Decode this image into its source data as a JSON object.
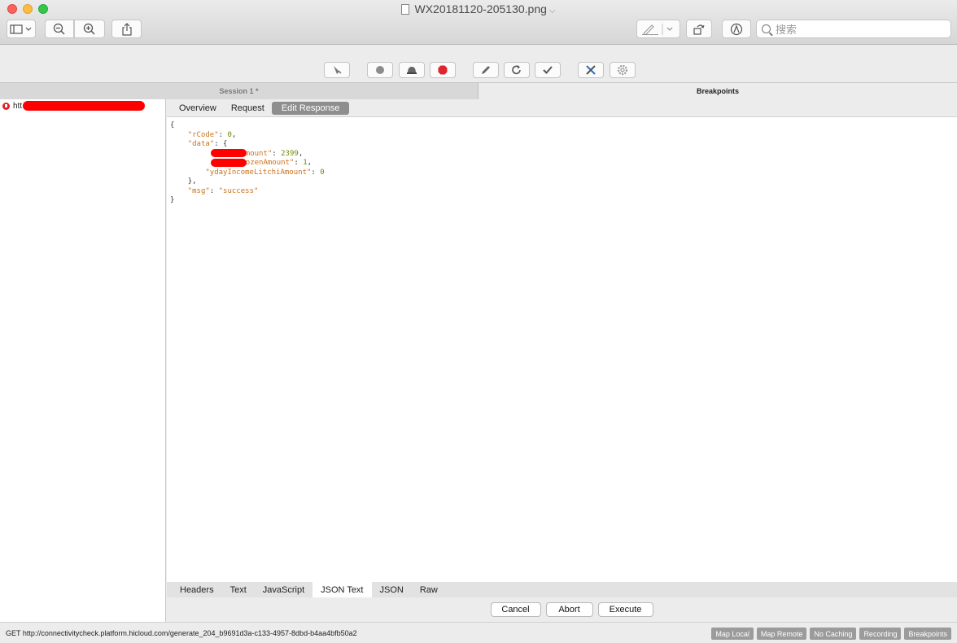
{
  "window": {
    "title": "WX20181120-205130.png",
    "title_chevron": "⌵",
    "search_placeholder": "搜索"
  },
  "charles_toolbar": {
    "icons": [
      "broom-icon",
      "record-icon",
      "throttle-icon",
      "breakpoint-icon",
      "edit-icon",
      "repeat-icon",
      "validate-icon",
      "tools-icon",
      "settings-icon"
    ],
    "breakpoint_color": "#e0242b"
  },
  "header": {
    "session_tab": "Session 1 *",
    "breakpoints_tab": "Breakpoints"
  },
  "tree": {
    "row_label": "htt…              …/account/"
  },
  "tabs_top": [
    "Overview",
    "Request",
    "Edit Response"
  ],
  "active_top_tab": "Edit Response",
  "editor": {
    "lines": [
      "{",
      "    \"rCode\": 0,",
      "    \"data\": {",
      "        \"         Amount\": 2399,",
      "        \"        rozenAmount\": 1,",
      "        \"ydayIncomeLitchiAmount\": 0",
      "    },",
      "    \"msg\": \"success\"",
      "}"
    ],
    "l1_brace": "{",
    "l2_key": "\"rCode\"",
    "l2_val": "0",
    "l3_key": "\"data\"",
    "l3_brace": "{",
    "l4_key": "Amount\"",
    "l4_val": "2399",
    "l5_key": "rozenAmount\"",
    "l5_val": "1",
    "l6_key": "\"ydayIncomeLitchiAmount\"",
    "l6_val": "0",
    "l7": "},",
    "l8_key": "\"msg\"",
    "l8_val": "\"success\"",
    "l9": "}"
  },
  "tabs_bottom": [
    "Headers",
    "Text",
    "JavaScript",
    "JSON Text",
    "JSON",
    "Raw"
  ],
  "active_bottom_tab": "JSON Text",
  "actions": {
    "cancel": "Cancel",
    "abort": "Abort",
    "execute": "Execute"
  },
  "status": {
    "text": "GET http://connectivitycheck.platform.hicloud.com/generate_204_b9691d3a-c133-4957-8dbd-b4aa4bfb50a2",
    "badges": [
      "Map Local",
      "Map Remote",
      "No Caching",
      "Recording",
      "Breakpoints"
    ]
  }
}
